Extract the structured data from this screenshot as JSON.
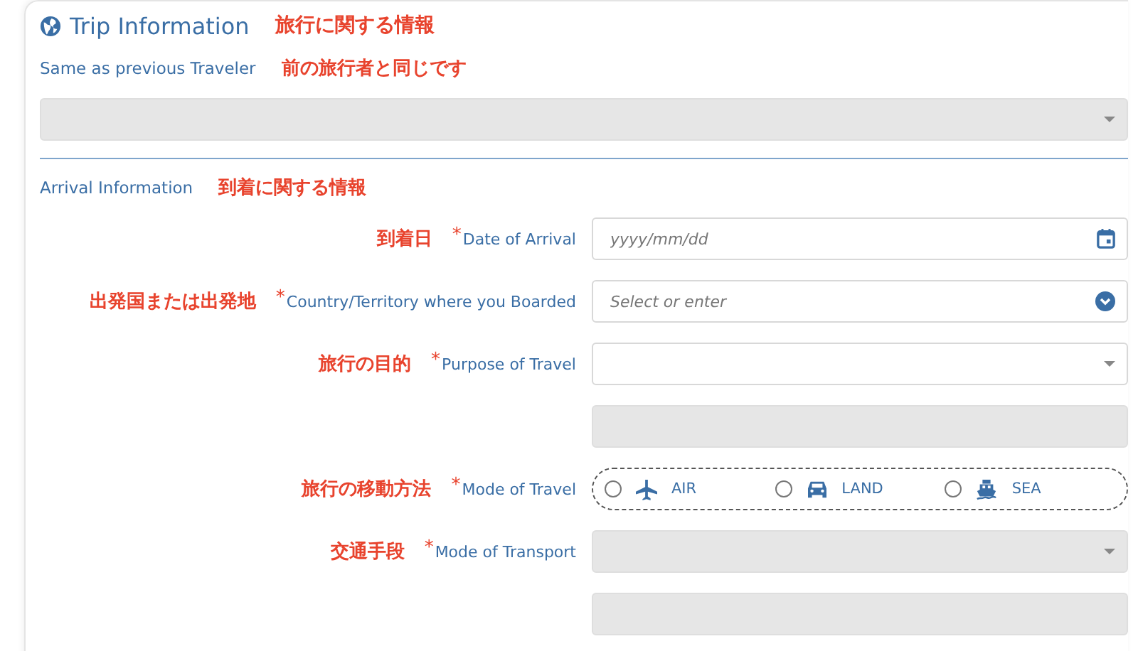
{
  "section": {
    "title": "Trip Information",
    "title_ja": "旅行に関する情報"
  },
  "same_as_previous": {
    "label": "Same as previous Traveler",
    "label_ja": "前の旅行者と同じです",
    "select": {
      "kind": "select",
      "disabled": true
    }
  },
  "arrival": {
    "title": "Arrival Information",
    "title_ja": "到着に関する情報",
    "fields": [
      {
        "kind": "date",
        "label_ja": "到着日",
        "label": "Date of Arrival",
        "required_mark": "*",
        "placeholder": "yyyy/mm/dd",
        "disabled": false
      },
      {
        "kind": "combo",
        "label_ja": "出発国または出発地",
        "label": "Country/Territory where you Boarded",
        "required_mark": "*",
        "placeholder": "Select or enter",
        "disabled": false
      },
      {
        "kind": "select",
        "label_ja": "旅行の目的",
        "label": "Purpose of Travel",
        "required_mark": "*",
        "disabled": false
      },
      {
        "kind": "text",
        "disabled": true
      },
      {
        "kind": "radio",
        "label_ja": "旅行の移動方法",
        "label": "Mode of Travel",
        "required_mark": "*",
        "options": [
          {
            "label": "AIR",
            "selected": false
          },
          {
            "label": "LAND",
            "selected": false
          },
          {
            "label": "SEA",
            "selected": false
          }
        ]
      },
      {
        "kind": "select",
        "label_ja": "交通手段",
        "label": "Mode of Transport",
        "required_mark": "*",
        "disabled": true
      },
      {
        "kind": "text",
        "disabled": true
      }
    ]
  }
}
